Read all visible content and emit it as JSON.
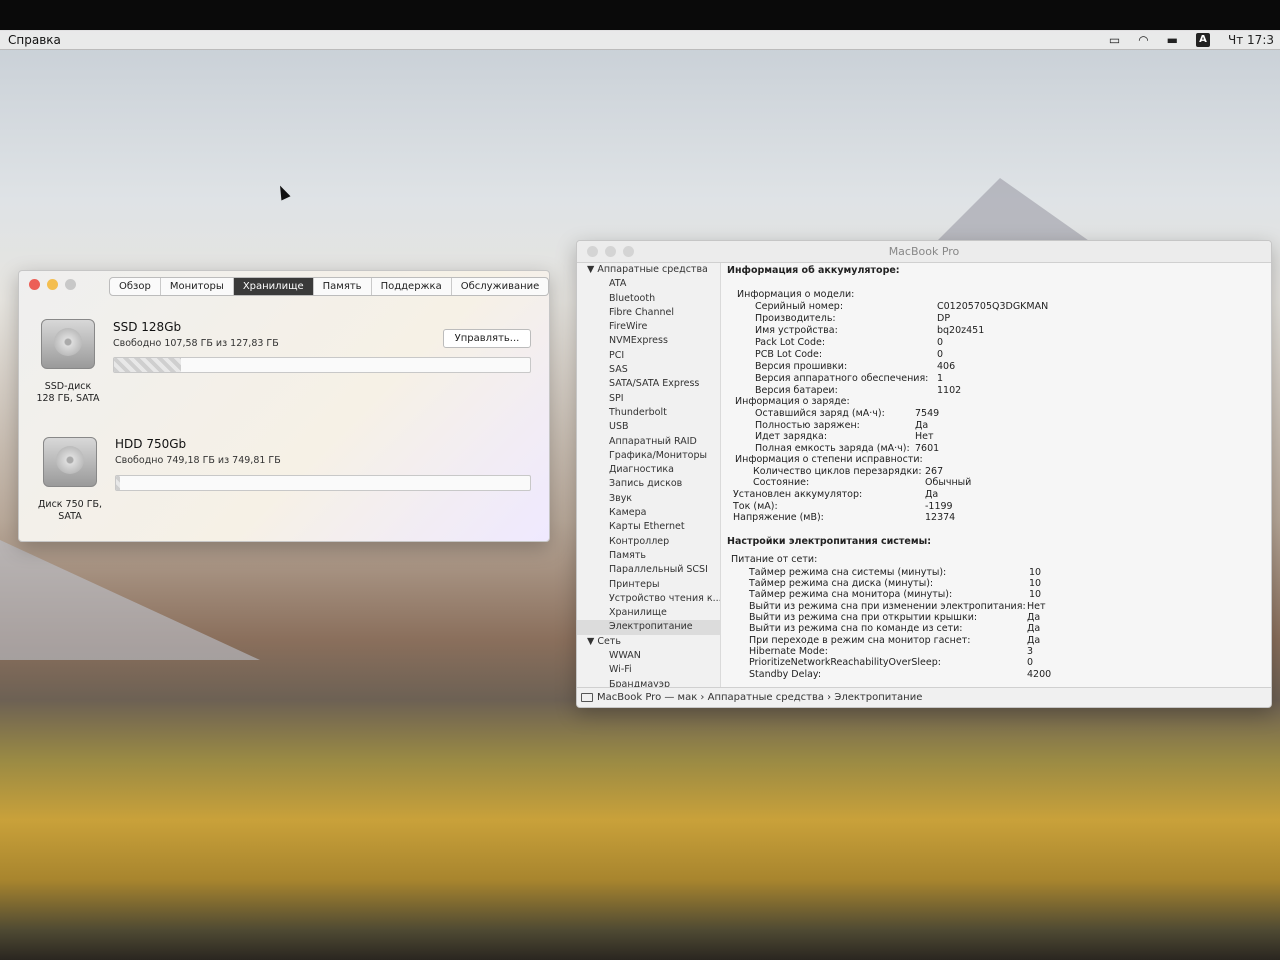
{
  "menubar": {
    "menu": "Справка",
    "clock": "Чт 17:3",
    "keyboard_badge": "A"
  },
  "storage_window": {
    "tabs": [
      "Обзор",
      "Мониторы",
      "Хранилище",
      "Память",
      "Поддержка",
      "Обслуживание"
    ],
    "active_tab": "Хранилище",
    "manage_button": "Управлять...",
    "disks": [
      {
        "name": "SSD 128Gb",
        "free": "Свободно 107,58 ГБ из 127,83 ГБ",
        "label_line1": "SSD-диск",
        "label_line2": "128 ГБ, SATA",
        "used_fraction": 0.16
      },
      {
        "name": "HDD 750Gb",
        "free": "Свободно 749,18 ГБ из 749,81 ГБ",
        "label_line1": "Диск 750 ГБ,",
        "label_line2": "SATA",
        "used_fraction": 0.01
      }
    ]
  },
  "sysinfo_window": {
    "title": "MacBook Pro",
    "sidebar": [
      {
        "label": "▼ Аппаратные средства",
        "group": true
      },
      {
        "label": "ATA"
      },
      {
        "label": "Bluetooth"
      },
      {
        "label": "Fibre Channel"
      },
      {
        "label": "FireWire"
      },
      {
        "label": "NVMExpress"
      },
      {
        "label": "PCI"
      },
      {
        "label": "SAS"
      },
      {
        "label": "SATA/SATA Express"
      },
      {
        "label": "SPI"
      },
      {
        "label": "Thunderbolt"
      },
      {
        "label": "USB"
      },
      {
        "label": "Аппаратный RAID"
      },
      {
        "label": "Графика/Мониторы"
      },
      {
        "label": "Диагностика"
      },
      {
        "label": "Запись дисков"
      },
      {
        "label": "Звук"
      },
      {
        "label": "Камера"
      },
      {
        "label": "Карты Ethernet"
      },
      {
        "label": "Контроллер"
      },
      {
        "label": "Память"
      },
      {
        "label": "Параллельный SCSI"
      },
      {
        "label": "Принтеры"
      },
      {
        "label": "Устройство чтения к..."
      },
      {
        "label": "Хранилище"
      },
      {
        "label": "Электропитание",
        "selected": true
      },
      {
        "label": "▼ Сеть",
        "group": true
      },
      {
        "label": "WWAN"
      },
      {
        "label": "Wi-Fi"
      },
      {
        "label": "Брандмауэр"
      }
    ],
    "content": [
      {
        "k": "Информация об аккумуляторе:",
        "v": "",
        "bold": true
      },
      {
        "k": "Информация о модели:",
        "v": ""
      },
      {
        "k": "Серийный номер:",
        "v": "C01205705Q3DGKMAN"
      },
      {
        "k": "Производитель:",
        "v": "DP"
      },
      {
        "k": "Имя устройства:",
        "v": "bq20z451"
      },
      {
        "k": "Pack Lot Code:",
        "v": "0"
      },
      {
        "k": "PCB Lot Code:",
        "v": "0"
      },
      {
        "k": "Версия прошивки:",
        "v": "406"
      },
      {
        "k": "Версия аппаратного обеспечения:",
        "v": "1"
      },
      {
        "k": "Версия батареи:",
        "v": "1102"
      },
      {
        "k": "Информация о заряде:",
        "v": ""
      },
      {
        "k": "Оставшийся заряд (мА·ч):",
        "v": "7549"
      },
      {
        "k": "Полностью заряжен:",
        "v": "Да"
      },
      {
        "k": "Идет зарядка:",
        "v": "Нет"
      },
      {
        "k": "Полная емкость заряда (мА·ч):",
        "v": "7601"
      },
      {
        "k": "Информация о степени исправности:",
        "v": ""
      },
      {
        "k": "Количество циклов перезарядки:",
        "v": "267"
      },
      {
        "k": "Состояние:",
        "v": "Обычный"
      },
      {
        "k": "Установлен аккумулятор:",
        "v": "Да"
      },
      {
        "k": "Ток (мА):",
        "v": "-1199"
      },
      {
        "k": "Напряжение (мВ):",
        "v": "12374"
      },
      {
        "k": "Настройки электропитания системы:",
        "v": "",
        "bold": true
      },
      {
        "k": "Питание от сети:",
        "v": ""
      },
      {
        "k": "Таймер режима сна системы (минуты):",
        "v": "10"
      },
      {
        "k": "Таймер режима сна диска (минуты):",
        "v": "10"
      },
      {
        "k": "Таймер режима сна монитора (минуты):",
        "v": "10"
      },
      {
        "k": "Выйти из режима сна при изменении электропитания:",
        "v": "Нет"
      },
      {
        "k": "Выйти из режима сна при открытии крышки:",
        "v": "Да"
      },
      {
        "k": "Выйти из режима сна по команде из сети:",
        "v": "Да"
      },
      {
        "k": "При переходе в режим сна монитор гаснет:",
        "v": "Да"
      },
      {
        "k": "Hibernate Mode:",
        "v": "3"
      },
      {
        "k": "PrioritizeNetworkReachabilityOverSleep:",
        "v": "0"
      },
      {
        "k": "Standby Delay:",
        "v": "4200"
      }
    ],
    "breadcrumb": "MacBook Pro — мак  ›  Аппаратные средства  ›  Электропитание"
  }
}
